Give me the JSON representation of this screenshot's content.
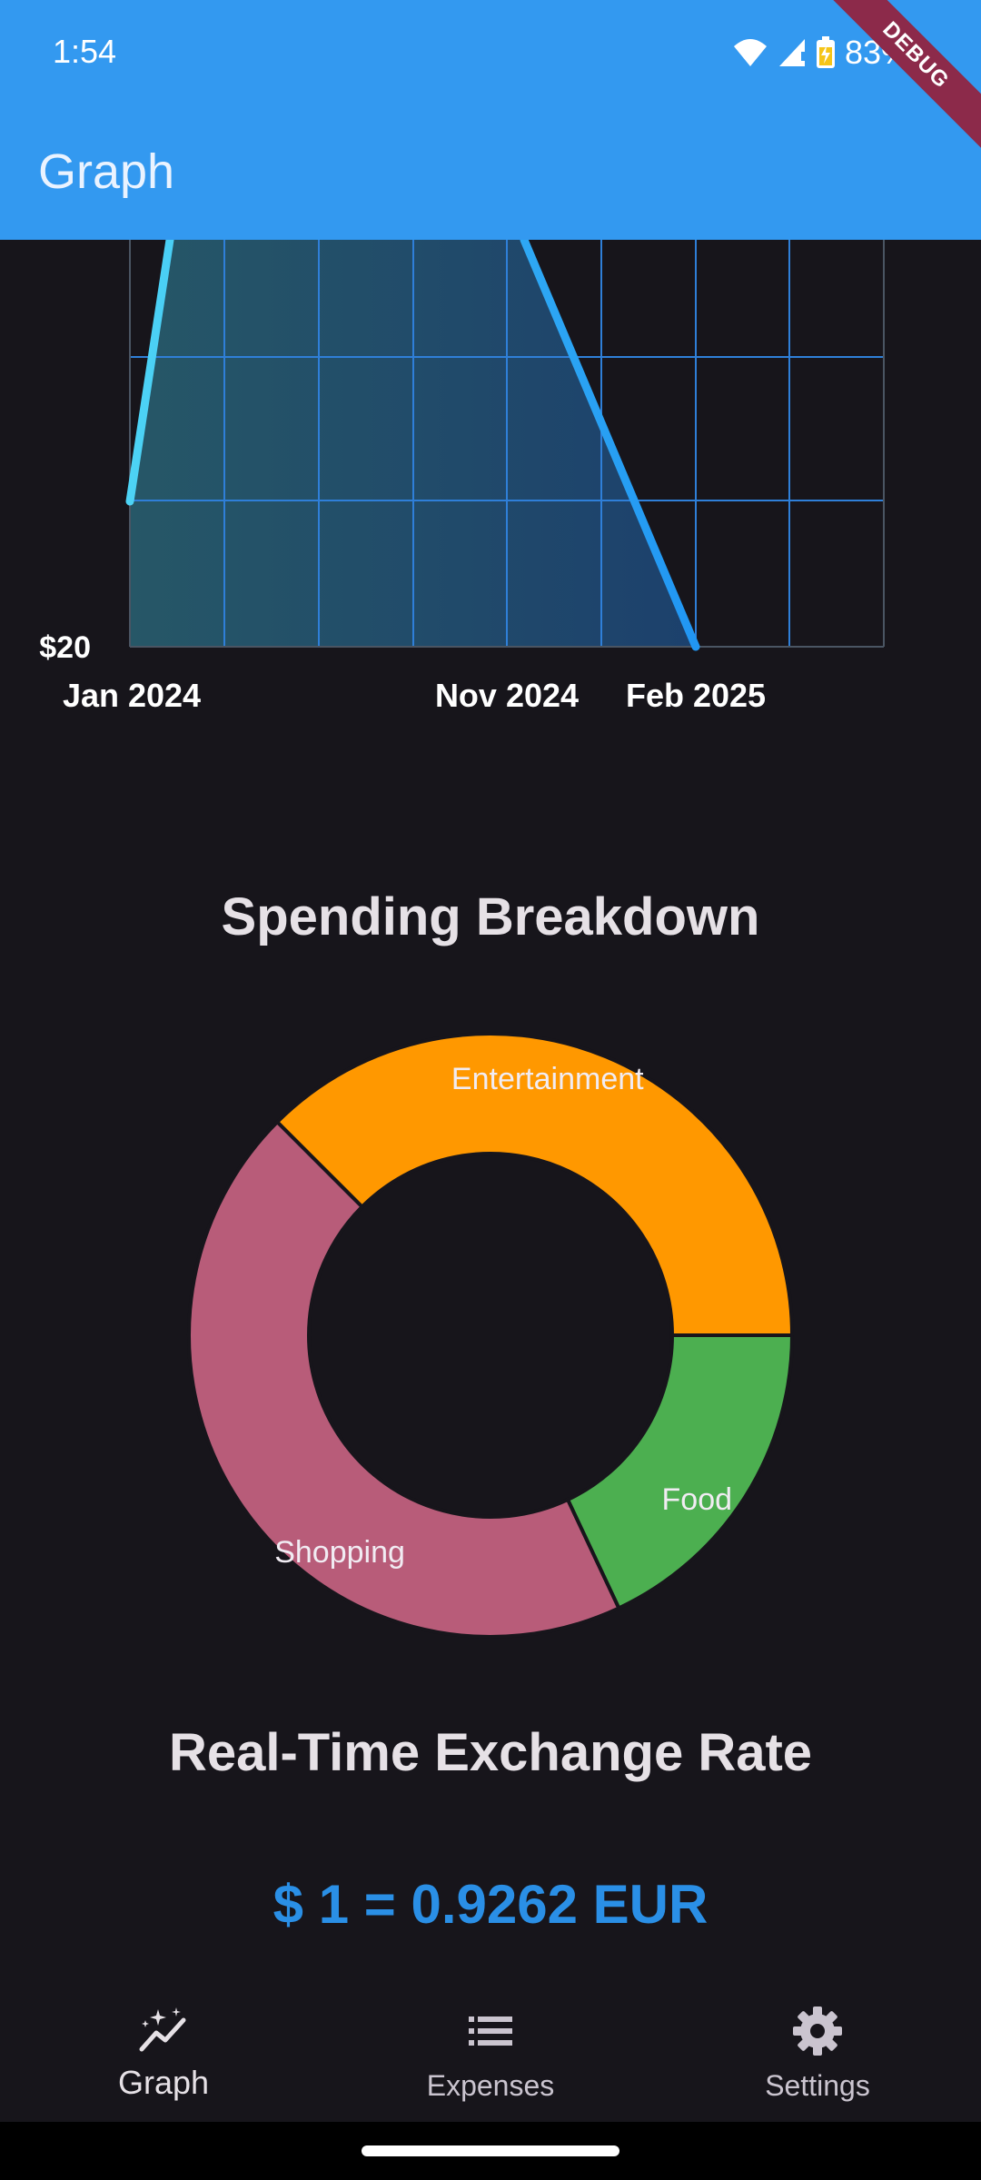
{
  "status_bar": {
    "time": "1:54",
    "battery": "83%",
    "icons": [
      "wifi-icon",
      "signal-icon",
      "battery-charging-icon"
    ]
  },
  "debug_banner": "DEBUG",
  "app_bar": {
    "title": "Graph",
    "color": "#3399f0"
  },
  "line_chart": {
    "y_label_visible": "$20",
    "x_ticks": [
      "Jan 2024",
      "Nov 2024",
      "Feb 2025"
    ],
    "colors": {
      "line_start": "#4dd3f5",
      "line_end": "#2196f3",
      "grid": "#2f7fd8"
    }
  },
  "chart_data": {
    "type": "pie",
    "title": "Spending Breakdown",
    "categories": [
      "Entertainment",
      "Shopping",
      "Food"
    ],
    "values": [
      37.5,
      44.5,
      18.0
    ],
    "colors": [
      "#ff9800",
      "#b85c79",
      "#4caf50"
    ]
  },
  "exchange_rate": {
    "title": "Real-Time Exchange Rate",
    "value": "$ 1 = 0.9262 EUR",
    "color": "#2a8fe6"
  },
  "bottom_nav": {
    "items": [
      {
        "label": "Graph",
        "icon": "insights-icon",
        "selected": true
      },
      {
        "label": "Expenses",
        "icon": "list-icon",
        "selected": false
      },
      {
        "label": "Settings",
        "icon": "gear-icon",
        "selected": false
      }
    ]
  }
}
